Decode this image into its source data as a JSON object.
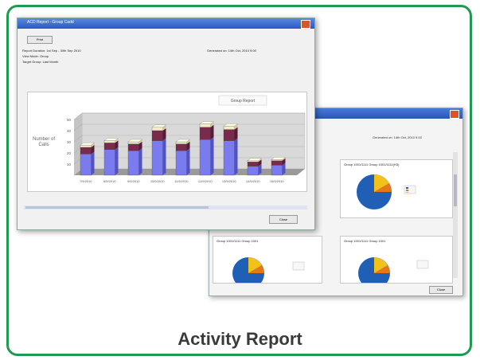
{
  "caption": "Activity Report",
  "front_window": {
    "title": "ACD Report - Group Cadd",
    "print_button": "Print",
    "report_duration": "Report Duration: 1st Sep - 30th Sep 2010",
    "view_mode": "View Mode: Group",
    "target_group": "Target Group: Last Month",
    "generated_on": "Generated on: 14th Oct, 2010 9:00",
    "close_button": "Close"
  },
  "back_window": {
    "generated_on": "Generated on: 14th Oct, 2010 9:00",
    "panel_titles": [
      "Group 1001/1111 Group 1001/1111(H3)",
      "Group 1001/1111 Group 1001",
      "Group 1001/1111 Group 1001"
    ],
    "close_button": "Close"
  },
  "colors": {
    "frame": "#1f9a4f",
    "bar_blue": "#7b7bf0",
    "bar_maroon": "#7a2a4a",
    "bar_cream": "#f2ecc8",
    "pie_blue": "#1f5fb5",
    "pie_orange": "#e6761a",
    "pie_yellow": "#f3c21a"
  },
  "chart_data": {
    "type": "bar",
    "title": "Group Report",
    "ylabel": "Number of Calls",
    "ylim": [
      0,
      50
    ],
    "yticks": [
      10,
      20,
      30,
      40,
      50
    ],
    "categories": [
      "7/9/2010",
      "8/9/2010",
      "9/9/2010",
      "10/9/2010",
      "11/9/2010",
      "12/9/2010",
      "13/9/2010",
      "14/9/2010",
      "15/9/2010"
    ],
    "series": [
      {
        "values": [
          19,
          23,
          22,
          31,
          22,
          32,
          31,
          8,
          9
        ]
      },
      {
        "values": [
          6,
          6,
          6,
          9,
          6,
          11,
          10,
          4,
          4
        ]
      },
      {
        "values": [
          2,
          2,
          2,
          3,
          2,
          3,
          3,
          1,
          1
        ]
      }
    ]
  }
}
